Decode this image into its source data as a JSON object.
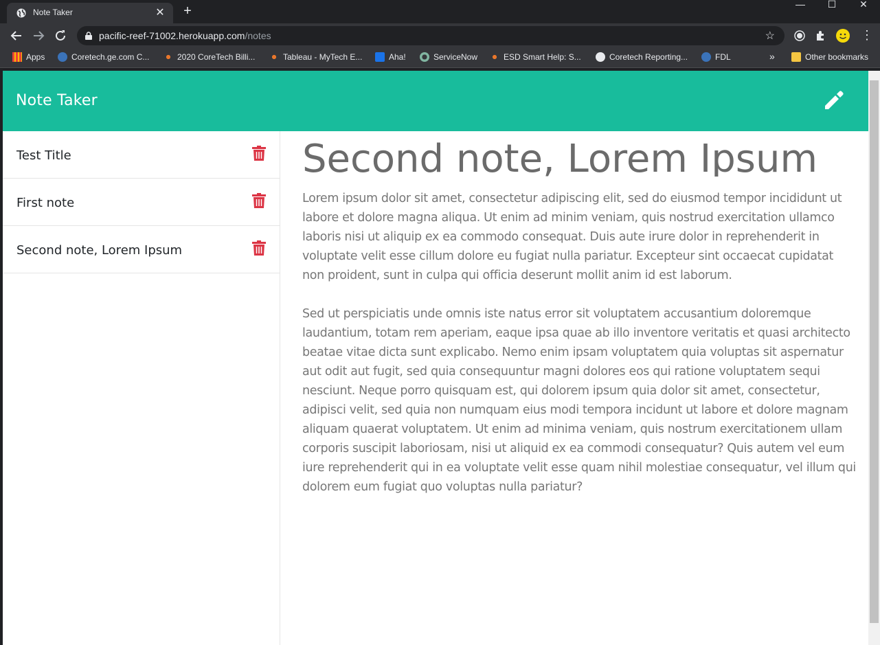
{
  "browser": {
    "tab_title": "Note Taker",
    "url_host": "pacific-reef-71002.herokuapp.com",
    "url_path": "/notes",
    "bookmarks": [
      "Apps",
      "Coretech.ge.com C...",
      "2020 CoreTech Billi...",
      "Tableau - MyTech E...",
      "Aha!",
      "ServiceNow",
      "ESD Smart Help: S...",
      "Coretech Reporting...",
      "FDL"
    ],
    "overflow": "»",
    "other_bookmarks": "Other bookmarks"
  },
  "app": {
    "brand": "Note Taker",
    "accent_color": "#18bc9c",
    "delete_color": "#dc3545"
  },
  "sidebar": {
    "notes": [
      {
        "title": "Test Title"
      },
      {
        "title": "First note"
      },
      {
        "title": "Second note, Lorem Ipsum"
      }
    ]
  },
  "main": {
    "note_title": "Second note, Lorem Ipsum",
    "paragraphs": [
      "Lorem ipsum dolor sit amet, consectetur adipiscing elit, sed do eiusmod tempor incididunt ut labore et dolore magna aliqua. Ut enim ad minim veniam, quis nostrud exercitation ullamco laboris nisi ut aliquip ex ea commodo consequat. Duis aute irure dolor in reprehenderit in voluptate velit esse cillum dolore eu fugiat nulla pariatur. Excepteur sint occaecat cupidatat non proident, sunt in culpa qui officia deserunt mollit anim id est laborum.",
      "Sed ut perspiciatis unde omnis iste natus error sit voluptatem accusantium doloremque laudantium, totam rem aperiam, eaque ipsa quae ab illo inventore veritatis et quasi architecto beatae vitae dicta sunt explicabo. Nemo enim ipsam voluptatem quia voluptas sit aspernatur aut odit aut fugit, sed quia consequuntur magni dolores eos qui ratione voluptatem sequi nesciunt. Neque porro quisquam est, qui dolorem ipsum quia dolor sit amet, consectetur, adipisci velit, sed quia non numquam eius modi tempora incidunt ut labore et dolore magnam aliquam quaerat voluptatem. Ut enim ad minima veniam, quis nostrum exercitationem ullam corporis suscipit laboriosam, nisi ut aliquid ex ea commodi consequatur? Quis autem vel eum iure reprehenderit qui in ea voluptate velit esse quam nihil molestiae consequatur, vel illum qui dolorem eum fugiat quo voluptas nulla pariatur?"
    ]
  },
  "icons": {
    "tab_favicon": "globe-icon",
    "pencil": "pencil-icon",
    "trash": "trash-icon"
  }
}
